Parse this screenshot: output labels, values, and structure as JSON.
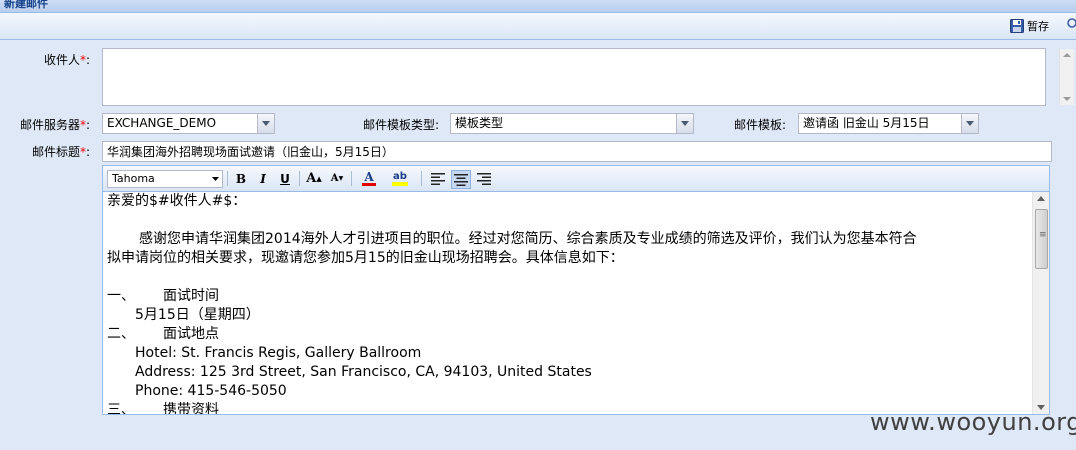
{
  "window": {
    "title": "新建邮件"
  },
  "toolbar": {
    "save_label": "暂存"
  },
  "form": {
    "recipient_label": "收件人",
    "recipient_value": "",
    "server_label": "邮件服务器",
    "server_value": "EXCHANGE_DEMO",
    "template_type_label": "邮件模板类型:",
    "template_type_value": "模板类型",
    "template_label": "邮件模板:",
    "template_value": "邀请函  旧金山  5月15日",
    "subject_label": "邮件标题",
    "subject_value": "华润集团海外招聘现场面试邀请（旧金山，5月15日）",
    "required_mark": "*",
    "colon": ":"
  },
  "editor_toolbar": {
    "font_family": "Tahoma",
    "bold": "B",
    "italic": "I",
    "underline": "U",
    "grow_font": "A",
    "shrink_font": "A",
    "font_color": "A",
    "highlight": "ab",
    "active_align": "center"
  },
  "editor_body": {
    "greeting": "亲爱的$#收件人#$：",
    "para1_line1": "感谢您申请华润集团2014海外人才引进项目的职位。经过对您简历、综合素质及专业成绩的筛选及评价，我们认为您基本符合",
    "para1_line2": "拟申请岗位的相关要求，现邀请您参加5月15的旧金山现场招聘会。具体信息如下：",
    "item1_num": "一、",
    "item1_title": "面试时间",
    "item1_detail": "5月15日（星期四）",
    "item2_num": "二、",
    "item2_title": "面试地点",
    "item2_hotel": "Hotel: St. Francis Regis, Gallery Ballroom",
    "item2_address": "Address: 125 3rd Street, San Francisco, CA, 94103, United States",
    "item2_phone": "Phone: 415-546-5050",
    "item3_num": "三、",
    "item3_title": "携带资料"
  },
  "watermark": "www.wooyun.org",
  "colors": {
    "panel_bg": "#dfe8f6",
    "border": "#99bbe8",
    "required": "#e00000",
    "font_color_bar": "#e00000",
    "highlight_bar": "#ffff00"
  }
}
